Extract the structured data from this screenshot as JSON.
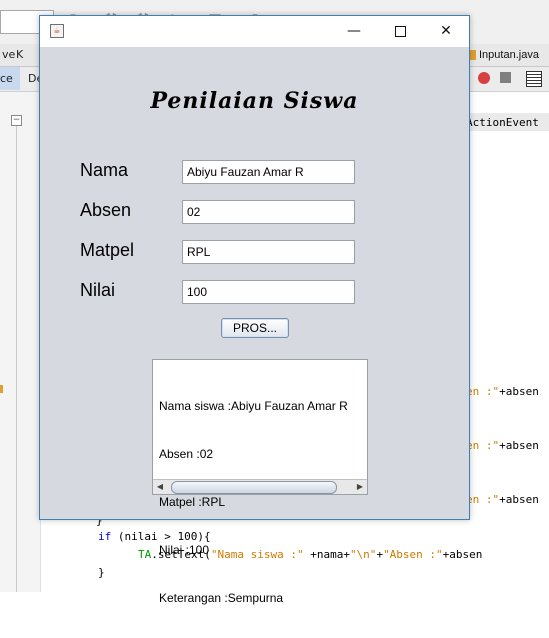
{
  "ide": {
    "left_tab_label": "ve",
    "left_tab2_label": "K",
    "right_tab_label": "Inputan.java",
    "source_tab_label": "ce",
    "design_tab_label": "De",
    "code_fragment_action": "ActionEvent",
    "code_fragment_absen": "en :\"+absen",
    "code_if": "if (nilai > 100){",
    "code_settext_obj": "TA",
    "code_settext_method": ".setText(",
    "code_settext_str1": "\"Nama siswa :\"",
    "code_settext_mid": " +nama+",
    "code_settext_str2": "\"\\n\"",
    "code_settext_plus": "+",
    "code_settext_str3": "\"Absen :\"",
    "code_settext_end": "+absen",
    "code_brace_close": "}"
  },
  "window": {
    "title": "",
    "heading": "Penilaian Siswa",
    "minimize_glyph": "—",
    "close_glyph": "✕"
  },
  "form": {
    "nama_label": "Nama",
    "nama_value": "Abiyu Fauzan Amar R",
    "absen_label": "Absen",
    "absen_value": "02",
    "matpel_label": "Matpel",
    "matpel_value": "RPL",
    "nilai_label": "Nilai",
    "nilai_value": "100",
    "process_button": "PROS..."
  },
  "output": {
    "lines": [
      "Nama siswa :Abiyu Fauzan Amar R",
      "Absen :02",
      "Matpel :RPL",
      "Nilai :100",
      "Keterangan :Sempurna"
    ]
  }
}
